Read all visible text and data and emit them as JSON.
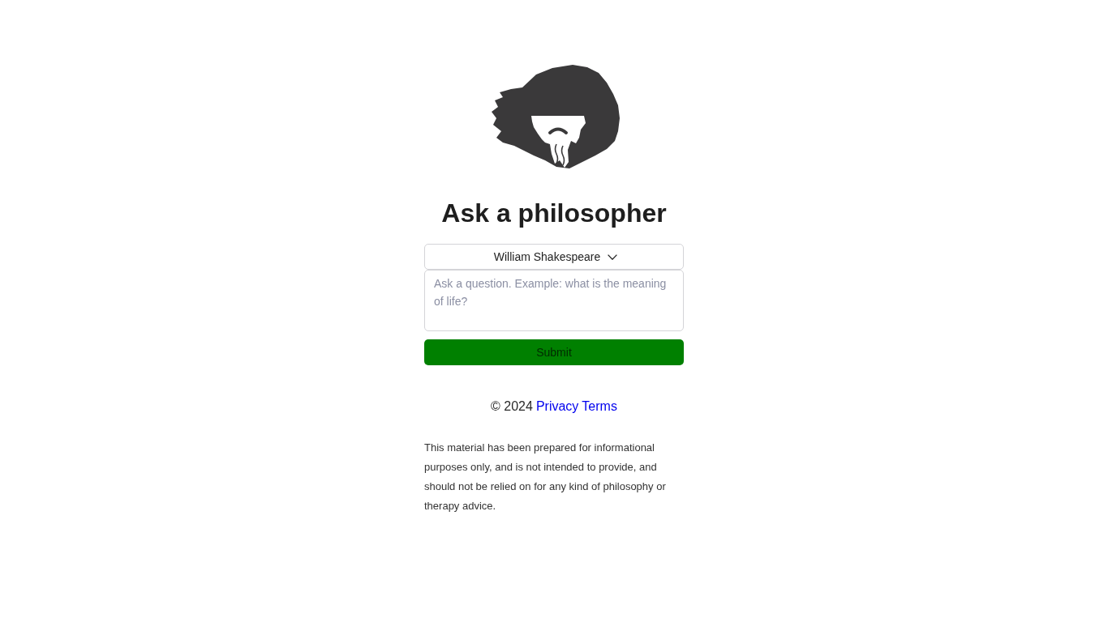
{
  "title": "Ask a philosopher",
  "philosopher_select": {
    "value": "William Shakespeare"
  },
  "question": {
    "placeholder": "Ask a question. Example: what is the meaning of life?"
  },
  "submit_button": "Submit",
  "footer": {
    "copyright": "© 2024",
    "links": [
      "Privacy",
      "Terms"
    ]
  },
  "disclaimer": "This material has been prepared for informational purposes only, and is not intended to provide, and should not be relied on for any kind of philosophy or therapy advice."
}
